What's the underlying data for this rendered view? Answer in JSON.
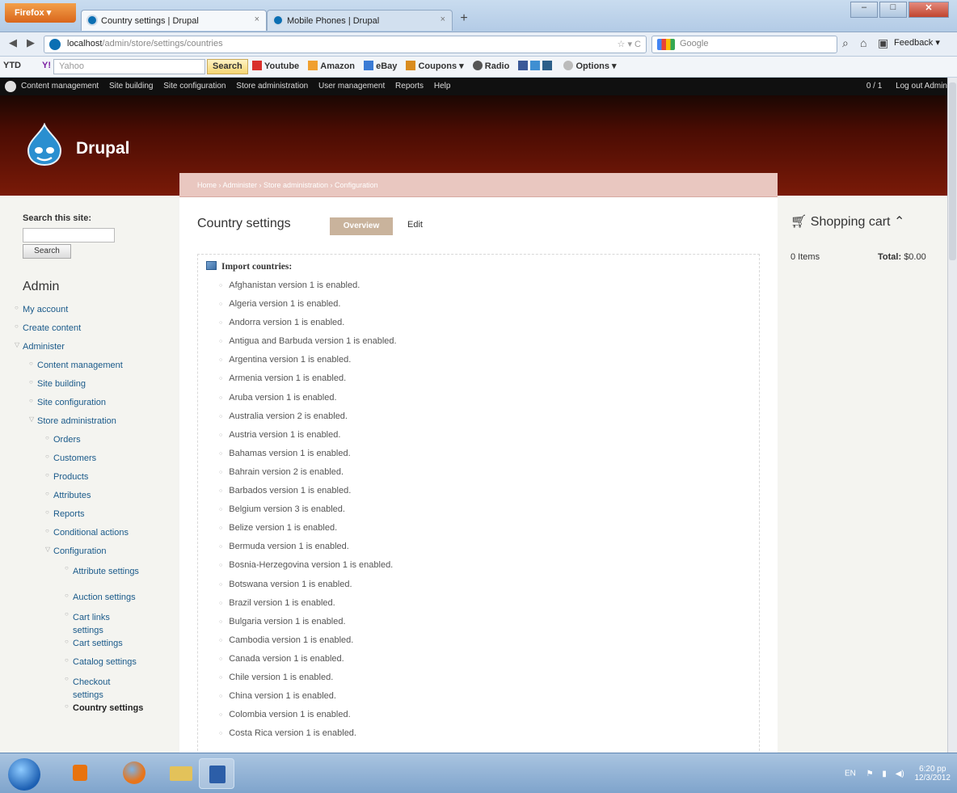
{
  "browser": {
    "menu_button": "Firefox ▾",
    "tabs": [
      {
        "title": "Country settings | Drupal",
        "close": "×"
      },
      {
        "title": "Mobile Phones | Drupal",
        "close": "×"
      }
    ],
    "new_tab": "+",
    "url_host": "localhost",
    "url_path": "/admin/store/settings/countries",
    "url_actions": "☆ ▾ C",
    "search_placeholder": "Google",
    "feedback_label": "Feedback ▾"
  },
  "toolbar": {
    "ytd": "YTD",
    "yahoo_icon": "Y!",
    "yahoo_placeholder": "Yahoo",
    "search_label": "Search",
    "links": [
      "Youtube",
      "Amazon",
      "eBay",
      "Coupons ▾",
      "Radio",
      "Options ▾"
    ]
  },
  "admin_menu": {
    "items": [
      "Content management",
      "Site building",
      "Site configuration",
      "Store administration",
      "User management",
      "Reports",
      "Help"
    ],
    "counter": "0 / 1",
    "logout": "Log out Admin"
  },
  "site": {
    "name": "Drupal"
  },
  "sidebar_left": {
    "search_label": "Search this site:",
    "search_button": "Search",
    "menu_title": "Admin",
    "items": [
      {
        "label": "My account",
        "level": 0
      },
      {
        "label": "Create content",
        "level": 0
      },
      {
        "label": "Administer",
        "level": 0
      },
      {
        "label": "Content management",
        "level": 1
      },
      {
        "label": "Site building",
        "level": 1
      },
      {
        "label": "Site configuration",
        "level": 1
      },
      {
        "label": "Store administration",
        "level": 1
      },
      {
        "label": "Orders",
        "level": 2
      },
      {
        "label": "Customers",
        "level": 2
      },
      {
        "label": "Products",
        "level": 2
      },
      {
        "label": "Attributes",
        "level": 2
      },
      {
        "label": "Reports",
        "level": 2
      },
      {
        "label": "Conditional actions",
        "level": 2
      },
      {
        "label": "Configuration",
        "level": 2
      },
      {
        "label": "Attribute settings",
        "level": 3
      },
      {
        "label": "Auction settings",
        "level": 3
      },
      {
        "label": "Cart links settings",
        "level": 3
      },
      {
        "label": "Cart settings",
        "level": 3
      },
      {
        "label": "Catalog settings",
        "level": 3
      },
      {
        "label": "Checkout settings",
        "level": 3
      },
      {
        "label": "Country settings",
        "level": 3
      }
    ]
  },
  "content": {
    "breadcrumb": "Home › Administer › Store administration › Configuration",
    "title": "Country settings",
    "tab_overview": "Overview",
    "tab_edit": "Edit",
    "log_title": "Import countries:",
    "countries": [
      "Afghanistan version 1 is enabled.",
      "Algeria version 1 is enabled.",
      "Andorra version 1 is enabled.",
      "Antigua and Barbuda version 1 is enabled.",
      "Argentina version 1 is enabled.",
      "Armenia version 1 is enabled.",
      "Aruba version 1 is enabled.",
      "Australia version 2 is enabled.",
      "Austria version 1 is enabled.",
      "Bahamas version 1 is enabled.",
      "Bahrain version 2 is enabled.",
      "Barbados version 1 is enabled.",
      "Belgium version 3 is enabled.",
      "Belize version 1 is enabled.",
      "Bermuda version 1 is enabled.",
      "Bosnia-Herzegovina version 1 is enabled.",
      "Botswana version 1 is enabled.",
      "Brazil version 1 is enabled.",
      "Bulgaria version 1 is enabled.",
      "Cambodia version 1 is enabled.",
      "Canada version 1 is enabled.",
      "Chile version 1 is enabled.",
      "China version 1 is enabled.",
      "Colombia version 1 is enabled.",
      "Costa Rica version 1 is enabled."
    ]
  },
  "cart": {
    "title": "Shopping cart",
    "items": "0 Items",
    "total_label": "Total:",
    "total_value": "$0.00"
  },
  "taskbar": {
    "lang": "EN",
    "time": "6:20 pp",
    "date": "12/3/2012"
  },
  "colors": {
    "header_dark": "#4a0c03",
    "breadcrumb_bg": "#e9c7c0",
    "tab_overview_bg": "#c9b39c",
    "link_color": "#1a5a8a"
  }
}
